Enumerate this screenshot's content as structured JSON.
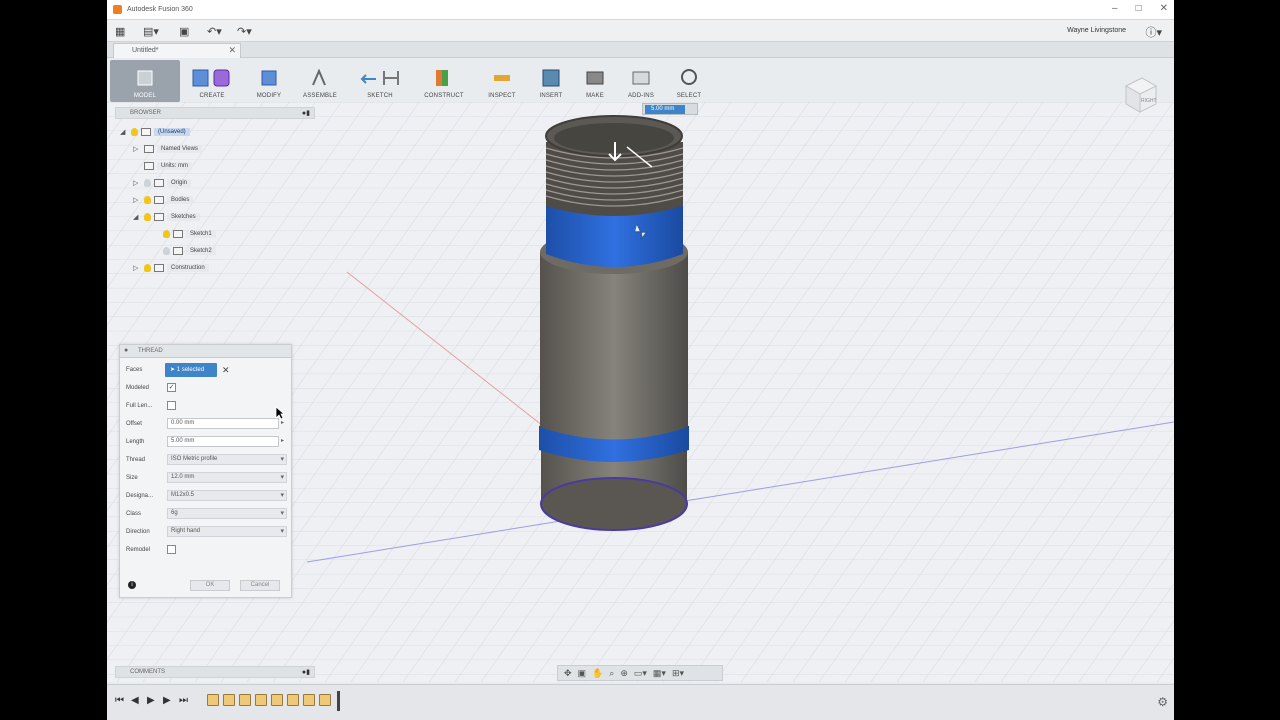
{
  "window": {
    "title": "Autodesk Fusion 360",
    "user": "Wayne Livingstone",
    "help": "?"
  },
  "tab": {
    "label": "Untitled*"
  },
  "toolbar": {
    "workspace": "MODEL",
    "groups": [
      "CREATE",
      "MODIFY",
      "ASSEMBLE",
      "SKETCH",
      "CONSTRUCT",
      "INSPECT",
      "INSERT",
      "MAKE",
      "ADD-INS",
      "SELECT"
    ]
  },
  "browser": {
    "header": "BROWSER",
    "items": [
      "(Unsaved)",
      "Named Views",
      "Units: mm",
      "Origin",
      "Bodies",
      "Sketches",
      "Sketch1",
      "Sketch2",
      "Construction"
    ]
  },
  "dialog": {
    "title": "THREAD",
    "faces_label": "Faces",
    "faces_value": "1 selected",
    "modeled_label": "Modeled",
    "full_length_label": "Full Len...",
    "offset_label": "Offset",
    "offset_value": "0.00 mm",
    "length_label": "Length",
    "length_value": "5.00 mm",
    "thread_label": "Thread",
    "thread_value": "ISO Metric profile",
    "size_label": "Size",
    "size_value": "12.0 mm",
    "designation_label": "Designa...",
    "designation_value": "M12x0.5",
    "class_label": "Class",
    "class_value": "6g",
    "direction_label": "Direction",
    "direction_value": "Right hand",
    "remodel_label": "Remodel",
    "ok": "OK",
    "cancel": "Cancel"
  },
  "viewport": {
    "distance_value": "5.00 mm",
    "viewcube_label": "RIGHT"
  },
  "comments": {
    "header": "COMMENTS"
  },
  "colors": {
    "accent": "#3d85c8",
    "body": "#6f6d68",
    "thread_face": "#1e64d8"
  }
}
